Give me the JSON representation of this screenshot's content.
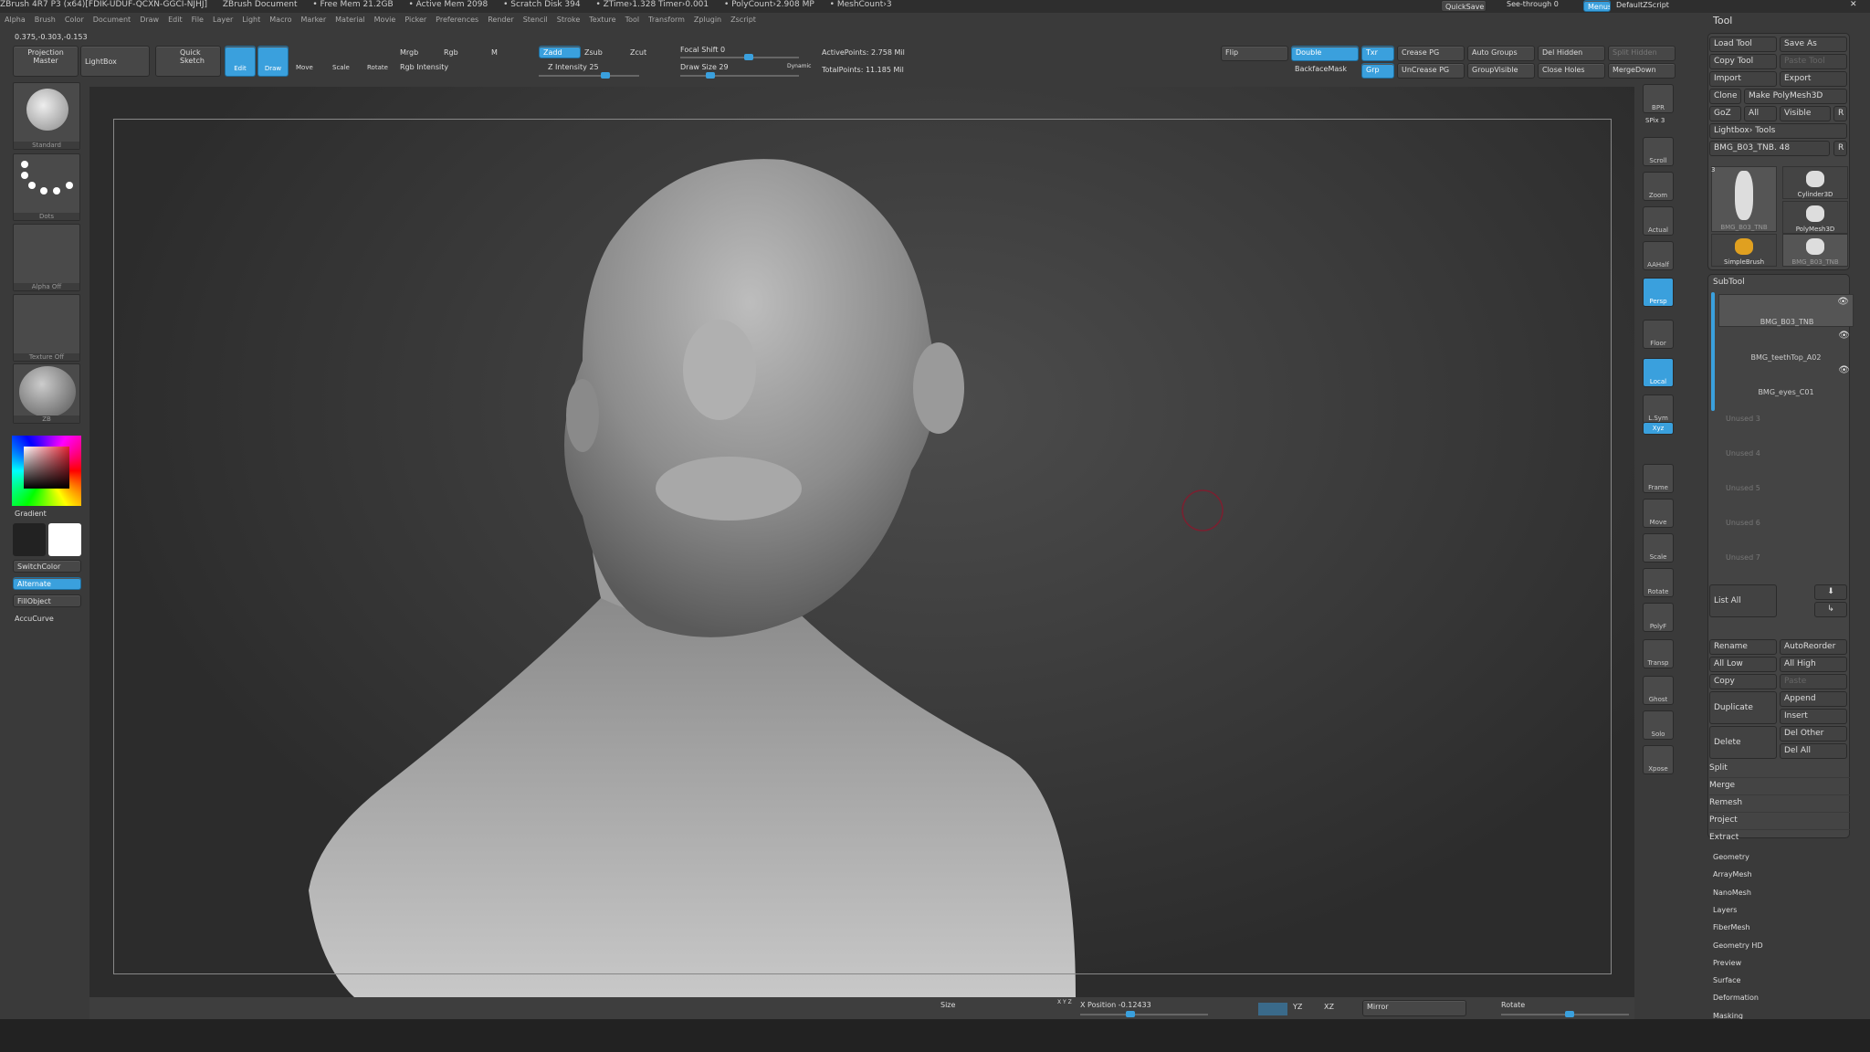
{
  "titlebar": {
    "app": "ZBrush 4R7 P3 (x64)[FDIK-UDUF-QCXN-GGCI-NJHJ]",
    "doc": "ZBrush Document",
    "free_mem": "• Free Mem 21.2GB",
    "active_mem": "• Active Mem 2098",
    "scratch": "• Scratch Disk 394",
    "ztime": "• ZTime›1.328 Timer›0.001",
    "polycount": "• PolyCount›2.908 MP",
    "meshcount": "• MeshCount›3"
  },
  "menus": [
    "Alpha",
    "Brush",
    "Color",
    "Document",
    "Draw",
    "Edit",
    "File",
    "Layer",
    "Light",
    "Macro",
    "Marker",
    "Material",
    "Movie",
    "Picker",
    "Preferences",
    "Render",
    "Stencil",
    "Stroke",
    "Texture",
    "Tool",
    "Transform",
    "Zplugin",
    "Zscript"
  ],
  "coords": "0.375,-0.303,-0.153",
  "top_right": {
    "quicksave": "QuickSave",
    "see_through": "See-through  0",
    "menus": "Menus",
    "script": "DefaultZScript"
  },
  "toolbar": {
    "projection_master": "Projection Master",
    "lightbox": "LightBox",
    "quick_sketch": "Quick Sketch",
    "edit": "Edit",
    "draw": "Draw",
    "move": "Move",
    "scale": "Scale",
    "rotate": "Rotate",
    "mrgb": "Mrgb",
    "rgb": "Rgb",
    "m": "M",
    "rgb_intensity": "Rgb Intensity",
    "zadd": "Zadd",
    "zsub": "Zsub",
    "zcut": "Zcut",
    "z_intensity": "Z Intensity 25",
    "focal_shift": "Focal Shift 0",
    "draw_size": "Draw Size 29",
    "dynamic": "Dynamic",
    "active_points": "ActivePoints: 2.758 Mil",
    "total_points": "TotalPoints: 11.185 Mil",
    "z_intensity_value": 25,
    "draw_size_value": 29,
    "focal_shift_value": 0
  },
  "geom_buttons": {
    "flip": "Flip",
    "double": "Double",
    "txr": "Txr",
    "crease_pg": "Crease PG",
    "auto_groups": "Auto Groups",
    "del_hidden": "Del Hidden",
    "split_hidden": "Split Hidden",
    "backface": "BackfaceMask",
    "grp": "Grp",
    "uncrease_pg": "UnCrease PG",
    "group_visible": "GroupVisible",
    "close_holes": "Close Holes",
    "merge_down": "MergeDown"
  },
  "left_shelf": {
    "brush": "Standard",
    "stroke": "Dots",
    "alpha": "Alpha  Off",
    "texture": "Texture  Off",
    "material": "ZB",
    "gradient": "Gradient",
    "switch_color": "SwitchColor",
    "alternate": "Alternate",
    "fill_object": "FillObject",
    "accucurve": "AccuCurve"
  },
  "right_tools": [
    "BPR",
    "Scroll",
    "Zoom",
    "Actual",
    "AAHalf",
    "Persp",
    "Floor",
    "Local",
    "L.Sym",
    "Xyz",
    "Frame",
    "Move",
    "Scale",
    "Rotate",
    "PolyF",
    "Transp",
    "Ghost",
    "Solo",
    "Xpose"
  ],
  "spix": "SPix 3",
  "tool_panel": {
    "title": "Tool",
    "load_tool": "Load Tool",
    "save_as": "Save As",
    "copy_tool": "Copy Tool",
    "paste_tool": "Paste Tool",
    "import": "Import",
    "export": "Export",
    "clone": "Clone",
    "make_polymesh": "Make PolyMesh3D",
    "goz": "GoZ",
    "all": "All",
    "visible": "Visible",
    "r": "R",
    "lightbox_tools": "Lightbox› Tools",
    "current_tool": "BMG_B03_TNB. 48",
    "thumbs": [
      "BMG_B03_TNB",
      "Cylinder3D",
      "PolyMesh3D",
      "SimpleBrush",
      "BMG_B03_TNB"
    ],
    "thumb_count": "3"
  },
  "subtool": {
    "title": "SubTool",
    "items": [
      "BMG_B03_TNB",
      "BMG_teethTop_A02",
      "BMG_eyes_C01"
    ],
    "unused": [
      "Unused 3",
      "Unused 4",
      "Unused 5",
      "Unused 6",
      "Unused 7"
    ],
    "list_all": "List All",
    "rename": "Rename",
    "autoreorder": "AutoReorder",
    "all_low": "All Low",
    "all_high": "All High",
    "copy": "Copy",
    "paste": "Paste",
    "duplicate": "Duplicate",
    "append": "Append",
    "insert": "Insert",
    "delete": "Delete",
    "del_other": "Del Other",
    "del_all": "Del All",
    "actions": [
      "Split",
      "Merge",
      "Remesh",
      "Project",
      "Extract"
    ]
  },
  "tool_sections": [
    "Geometry",
    "ArrayMesh",
    "NanoMesh",
    "Layers",
    "FiberMesh",
    "Geometry HD",
    "Preview",
    "Surface",
    "Deformation",
    "Masking"
  ],
  "bottom": {
    "size": "Size",
    "xyz": "X Y Z",
    "position": "X Position -0.12433",
    "yz": "YZ",
    "xz": "XZ",
    "mirror": "Mirror",
    "rotate": "Rotate"
  },
  "colors": {
    "accent": "#3aa0dd",
    "background": "#3a3a3a",
    "canvas": "#2e2e2e"
  }
}
